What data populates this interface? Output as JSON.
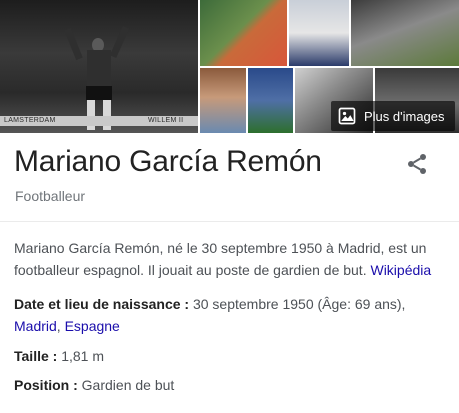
{
  "images": {
    "banner_text": "LAMSTERDAM",
    "banner_text_2": "WILLEM II",
    "more_images_label": "Plus d'images"
  },
  "header": {
    "title": "Mariano García Remón",
    "subtitle": "Footballeur"
  },
  "description": {
    "text": "Mariano García Remón, né le 30 septembre 1950 à Madrid, est un footballeur espagnol. Il jouait au poste de gardien de but.",
    "source_link": "Wikipédia"
  },
  "facts": {
    "birth": {
      "label": "Date et lieu de naissance :",
      "value": "30 septembre 1950 (Âge: 69 ans),",
      "place_city": "Madrid",
      "separator": ",",
      "place_country": "Espagne"
    },
    "height": {
      "label": "Taille :",
      "value": "1,81 m"
    },
    "position": {
      "label": "Position :",
      "value": "Gardien de but"
    }
  },
  "colors": {
    "link": "#1a0dab",
    "text": "#222222",
    "secondary": "#70757a",
    "body": "#4d5156"
  },
  "icons": {
    "share": "share-icon",
    "images": "image-gallery-icon"
  }
}
